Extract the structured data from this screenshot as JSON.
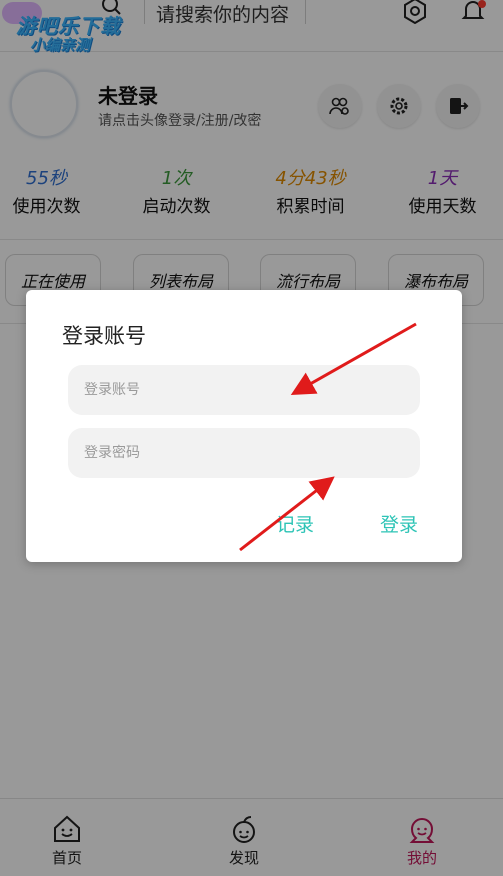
{
  "watermark": {
    "line1": "游吧乐下载",
    "line2": "小编亲测"
  },
  "search": {
    "placeholder": "请搜索你的内容"
  },
  "profile": {
    "name": "未登录",
    "subtitle": "请点击头像登录/注册/改密"
  },
  "stats": [
    {
      "value": "55秒",
      "label": "使用次数",
      "color": "#2f6fd0"
    },
    {
      "value": "1次",
      "label": "启动次数",
      "color": "#3c9a3c"
    },
    {
      "value": "4分43秒",
      "label": "积累时间",
      "color": "#e08a00"
    },
    {
      "value": "1天",
      "label": "使用天数",
      "color": "#8a2eb8"
    }
  ],
  "layouts": [
    "正在使用",
    "列表布局",
    "流行布局",
    "瀑布布局"
  ],
  "dialog": {
    "title": "登录账号",
    "account_placeholder": "登录账号",
    "password_placeholder": "登录密码",
    "record_label": "记录",
    "login_label": "登录",
    "accent": "#2ec4b6"
  },
  "nav": [
    {
      "label": "首页",
      "icon": "home-icon"
    },
    {
      "label": "发现",
      "icon": "discover-icon"
    },
    {
      "label": "我的",
      "icon": "profile-icon",
      "active": true,
      "color": "#c2185b"
    }
  ],
  "annotation_color": "#e01b1b"
}
